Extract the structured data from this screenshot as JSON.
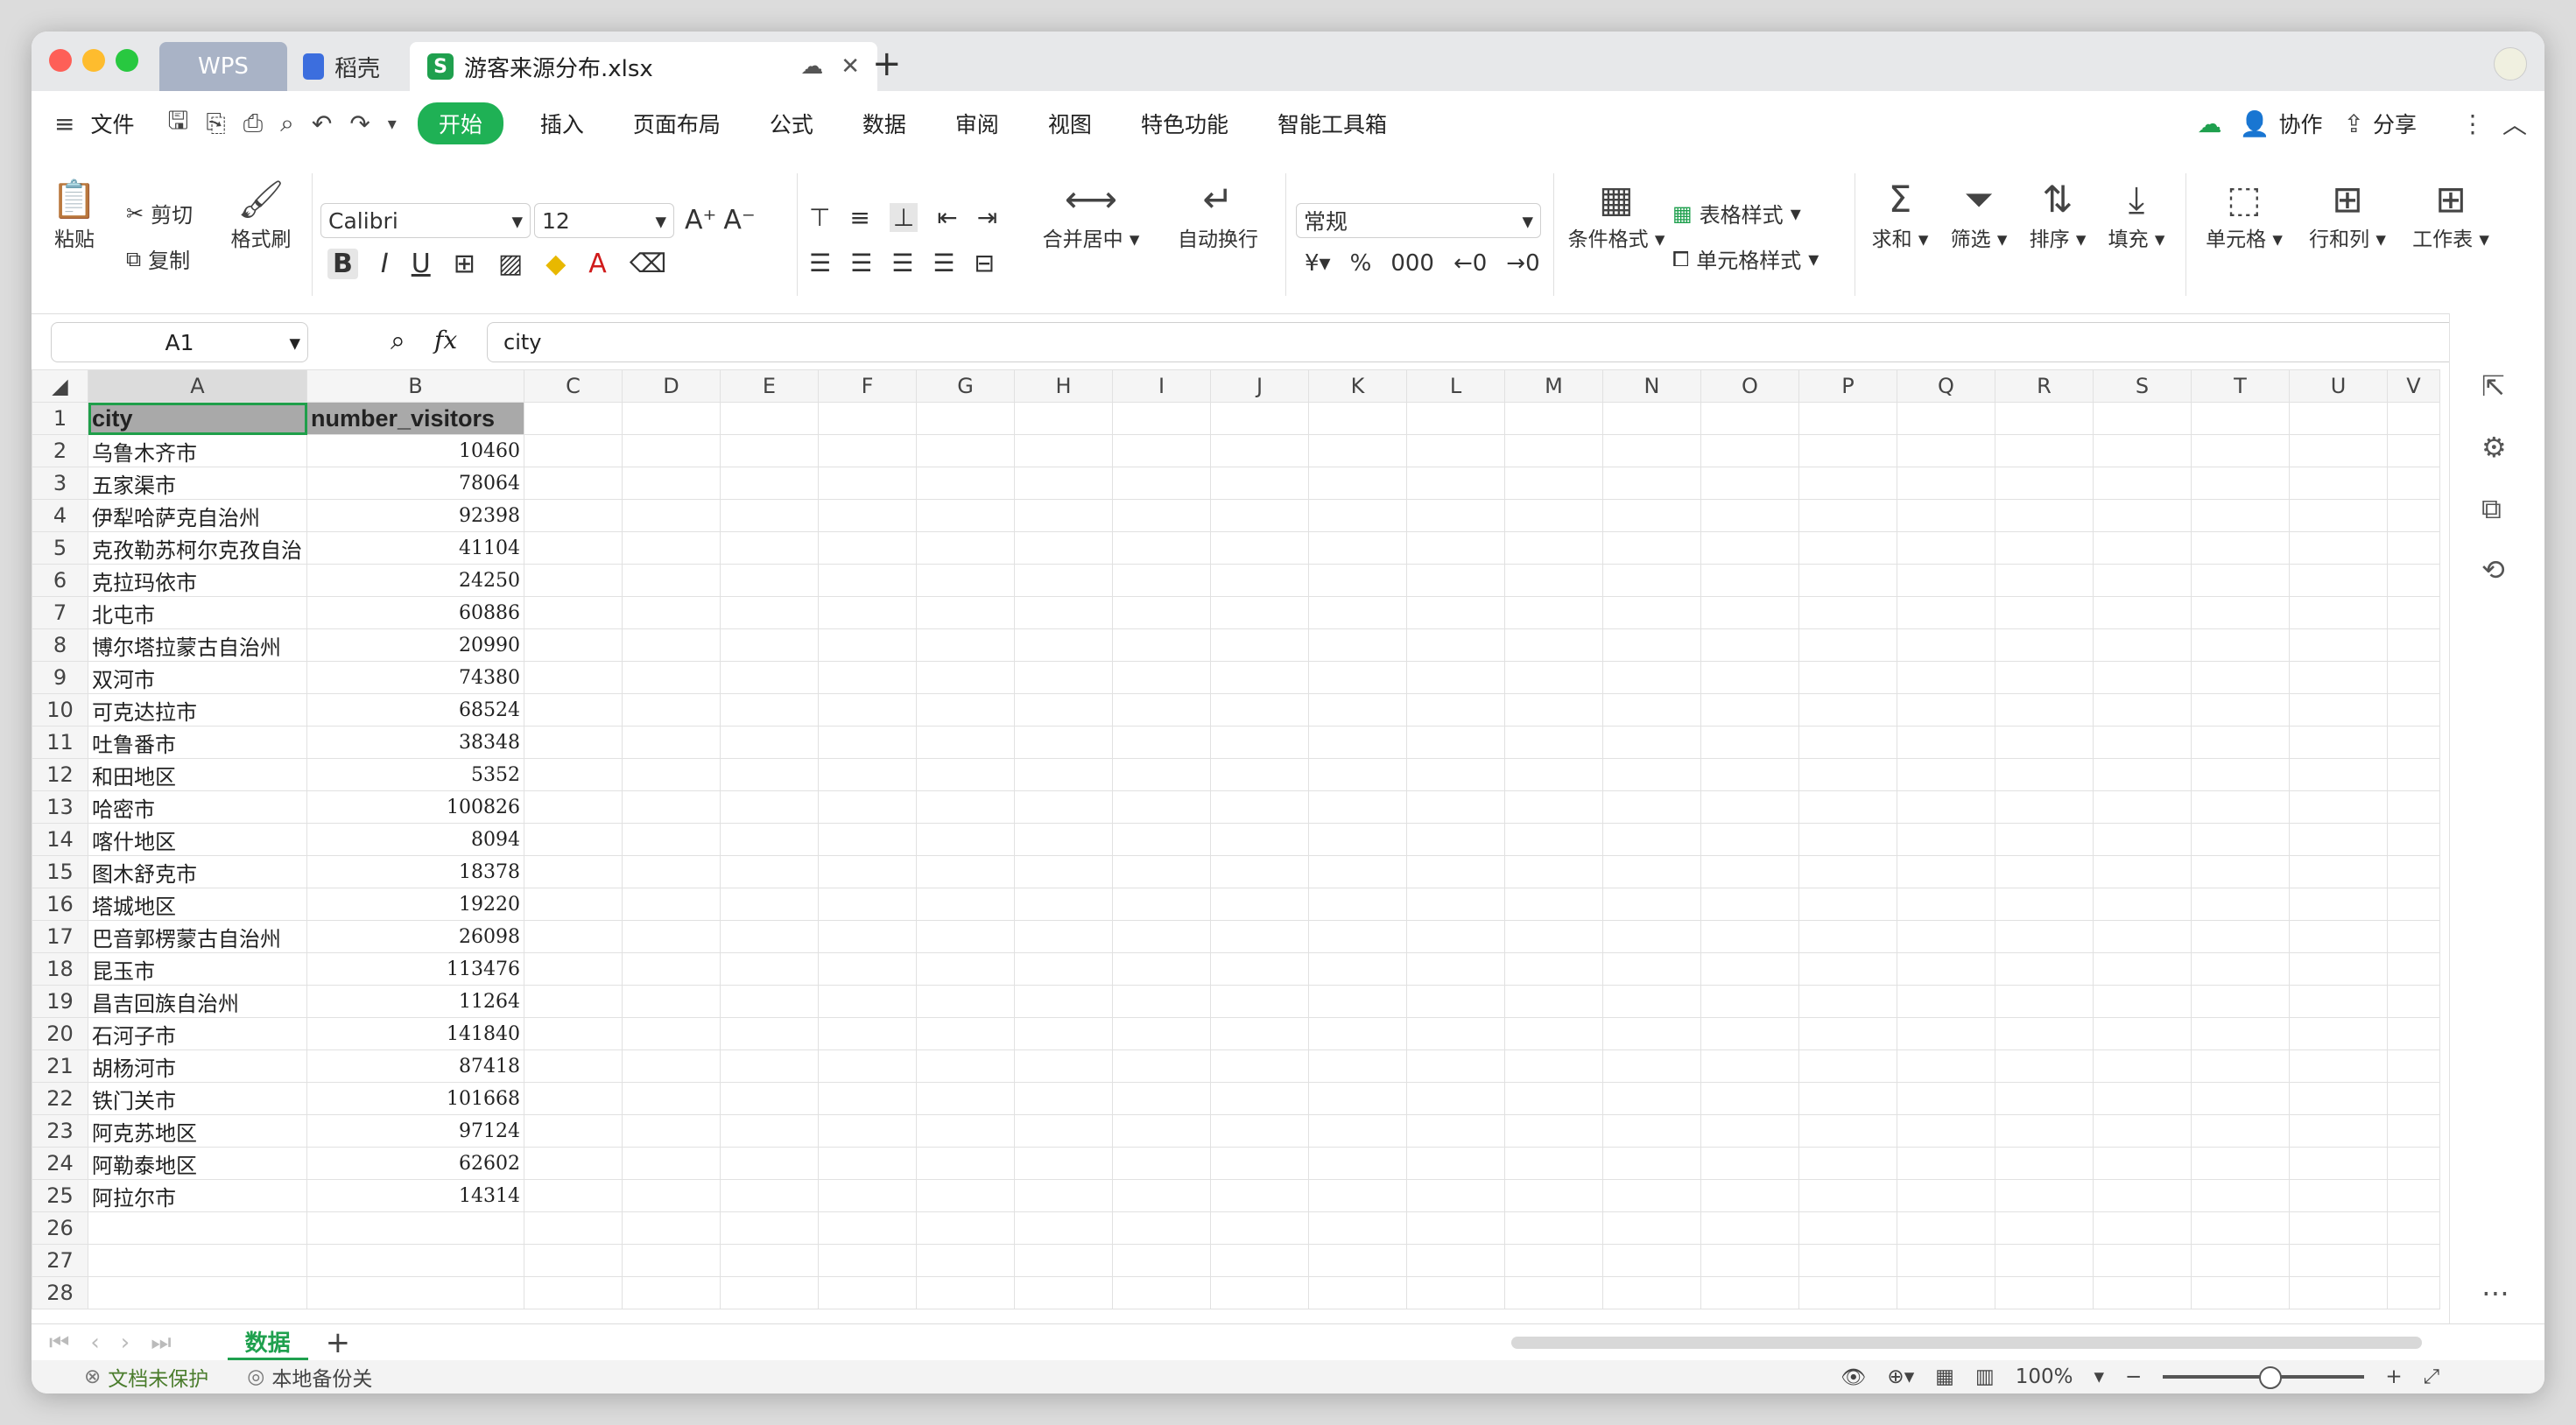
{
  "tabs": {
    "wps": "WPS",
    "daoke": "稻壳",
    "file": "游客来源分布.xlsx"
  },
  "menu": {
    "file": "文件",
    "items": [
      "开始",
      "插入",
      "页面布局",
      "公式",
      "数据",
      "审阅",
      "视图",
      "特色功能",
      "智能工具箱"
    ],
    "collab": "协作",
    "share": "分享"
  },
  "ribbon": {
    "paste": "粘贴",
    "cut": "剪切",
    "copy": "复制",
    "format_painter": "格式刷",
    "font": "Calibri",
    "size": "12",
    "merge": "合并居中",
    "wrap": "自动换行",
    "number_format": "常规",
    "cond_format": "条件格式",
    "table_style": "表格样式",
    "cell_style": "单元格样式",
    "sum": "求和",
    "filter": "筛选",
    "sort": "排序",
    "fill": "填充",
    "cell": "单元格",
    "rowcol": "行和列",
    "sheet": "工作表"
  },
  "formula": {
    "name_box": "A1",
    "fx": "fx",
    "content": "city"
  },
  "columns": [
    "A",
    "B",
    "C",
    "D",
    "E",
    "F",
    "G",
    "H",
    "I",
    "J",
    "K",
    "L",
    "M",
    "N",
    "O",
    "P",
    "Q",
    "R",
    "S",
    "T",
    "U",
    "V"
  ],
  "headers": {
    "a": "city",
    "b": "number_visitors"
  },
  "rows": [
    {
      "n": "2",
      "a": "乌鲁木齐市",
      "b": "10460"
    },
    {
      "n": "3",
      "a": "五家渠市",
      "b": "78064"
    },
    {
      "n": "4",
      "a": "伊犁哈萨克自治州",
      "b": "92398"
    },
    {
      "n": "5",
      "a": "克孜勒苏柯尔克孜自治",
      "b": "41104"
    },
    {
      "n": "6",
      "a": "克拉玛依市",
      "b": "24250"
    },
    {
      "n": "7",
      "a": "北屯市",
      "b": "60886"
    },
    {
      "n": "8",
      "a": "博尔塔拉蒙古自治州",
      "b": "20990"
    },
    {
      "n": "9",
      "a": "双河市",
      "b": "74380"
    },
    {
      "n": "10",
      "a": "可克达拉市",
      "b": "68524"
    },
    {
      "n": "11",
      "a": "吐鲁番市",
      "b": "38348"
    },
    {
      "n": "12",
      "a": "和田地区",
      "b": "5352"
    },
    {
      "n": "13",
      "a": "哈密市",
      "b": "100826"
    },
    {
      "n": "14",
      "a": "喀什地区",
      "b": "8094"
    },
    {
      "n": "15",
      "a": "图木舒克市",
      "b": "18378"
    },
    {
      "n": "16",
      "a": "塔城地区",
      "b": "19220"
    },
    {
      "n": "17",
      "a": "巴音郭楞蒙古自治州",
      "b": "26098"
    },
    {
      "n": "18",
      "a": "昆玉市",
      "b": "113476"
    },
    {
      "n": "19",
      "a": "昌吉回族自治州",
      "b": "11264"
    },
    {
      "n": "20",
      "a": "石河子市",
      "b": "141840"
    },
    {
      "n": "21",
      "a": "胡杨河市",
      "b": "87418"
    },
    {
      "n": "22",
      "a": "铁门关市",
      "b": "101668"
    },
    {
      "n": "23",
      "a": "阿克苏地区",
      "b": "97124"
    },
    {
      "n": "24",
      "a": "阿勒泰地区",
      "b": "62602"
    },
    {
      "n": "25",
      "a": "阿拉尔市",
      "b": "14314"
    },
    {
      "n": "26",
      "a": "",
      "b": ""
    },
    {
      "n": "27",
      "a": "",
      "b": ""
    },
    {
      "n": "28",
      "a": "",
      "b": ""
    }
  ],
  "sheet": {
    "name": "数据"
  },
  "status": {
    "protect": "文档未保护",
    "backup": "本地备份关",
    "zoom": "100%"
  }
}
